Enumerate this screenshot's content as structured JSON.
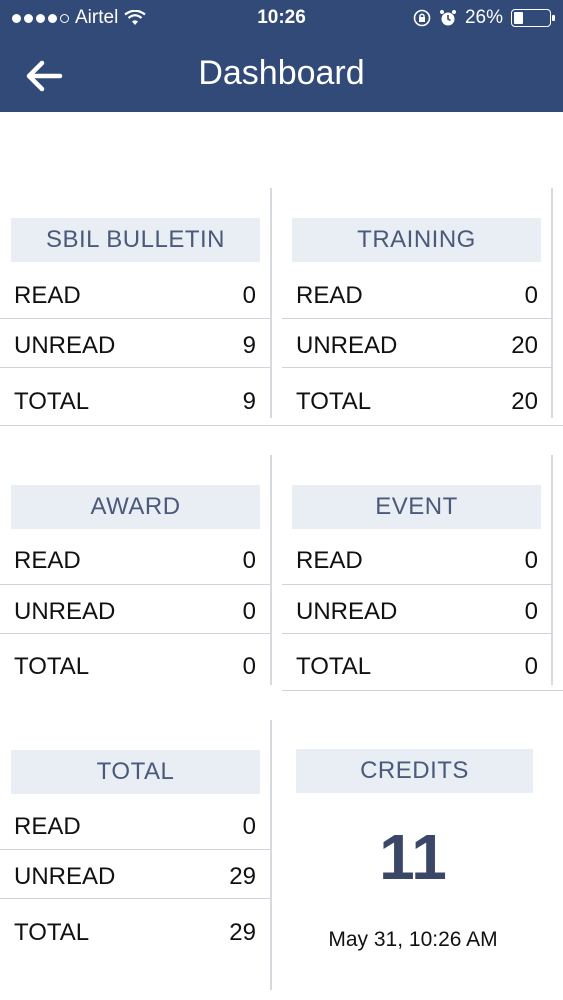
{
  "status": {
    "carrier": "Airtel",
    "time": "10:26",
    "battery": "26%",
    "battery_level": 0.26
  },
  "nav": {
    "title": "Dashboard"
  },
  "cards": {
    "sbil": {
      "title": "SBIL BULLETIN",
      "rows": [
        {
          "label": "READ",
          "value": "0"
        },
        {
          "label": "UNREAD",
          "value": "9"
        },
        {
          "label": "TOTAL",
          "value": "9"
        }
      ]
    },
    "training": {
      "title": "TRAINING",
      "rows": [
        {
          "label": "READ",
          "value": "0"
        },
        {
          "label": "UNREAD",
          "value": "20"
        },
        {
          "label": "TOTAL",
          "value": "20"
        }
      ]
    },
    "award": {
      "title": "AWARD",
      "rows": [
        {
          "label": "READ",
          "value": "0"
        },
        {
          "label": "UNREAD",
          "value": "0"
        },
        {
          "label": "TOTAL",
          "value": "0"
        }
      ]
    },
    "event": {
      "title": "EVENT",
      "rows": [
        {
          "label": "READ",
          "value": "0"
        },
        {
          "label": "UNREAD",
          "value": "0"
        },
        {
          "label": "TOTAL",
          "value": "0"
        }
      ]
    },
    "total": {
      "title": "TOTAL",
      "rows": [
        {
          "label": "READ",
          "value": "0"
        },
        {
          "label": "UNREAD",
          "value": "29"
        },
        {
          "label": "TOTAL",
          "value": "29"
        }
      ]
    },
    "credits": {
      "title": "CREDITS",
      "value": "11",
      "date": "May 31, 10:26 AM"
    }
  }
}
